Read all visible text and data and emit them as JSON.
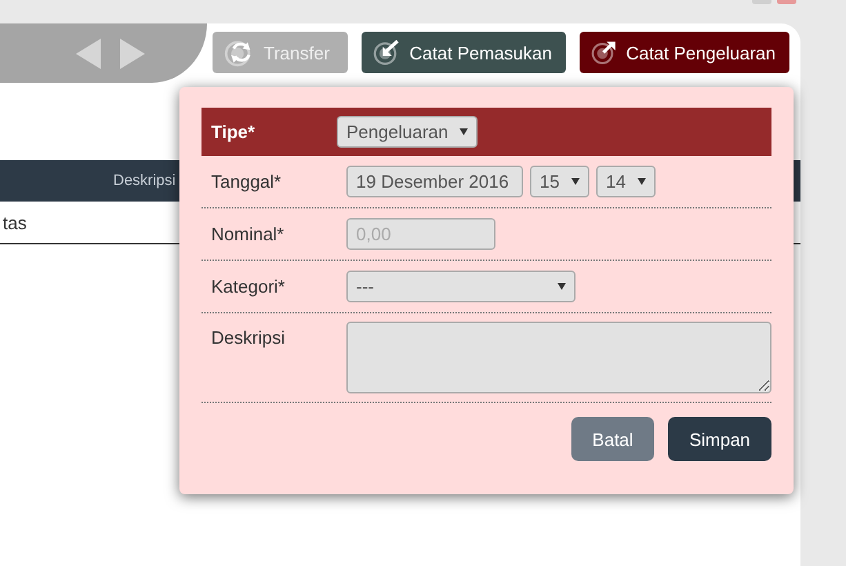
{
  "toolbar": {
    "buttons": [
      {
        "label": "Transfer",
        "kind": "transfer",
        "disabled": true
      },
      {
        "label": "Catat Pemasukan",
        "kind": "income",
        "disabled": false
      },
      {
        "label": "Catat Pengeluaran",
        "kind": "expense",
        "disabled": false
      }
    ]
  },
  "table": {
    "columns": [
      {
        "label": "Deskripsi"
      }
    ],
    "rows": [
      {
        "cell": "tas"
      }
    ]
  },
  "dialog": {
    "header": {
      "label": "Tipe*",
      "value": "Pengeluaran"
    },
    "fields": [
      {
        "kind": "datetime",
        "label": "Tanggal*",
        "value": "19 Desember 2016",
        "hour": "15",
        "minute": "14"
      },
      {
        "kind": "input",
        "label": "Nominal*",
        "placeholder": "0,00"
      },
      {
        "kind": "select",
        "label": "Kategori*",
        "value": "---"
      },
      {
        "kind": "textarea",
        "label": "Deskripsi"
      }
    ],
    "buttons": [
      {
        "label": "Batal",
        "kind": "cancel"
      },
      {
        "label": "Simpan",
        "kind": "primary"
      }
    ]
  }
}
